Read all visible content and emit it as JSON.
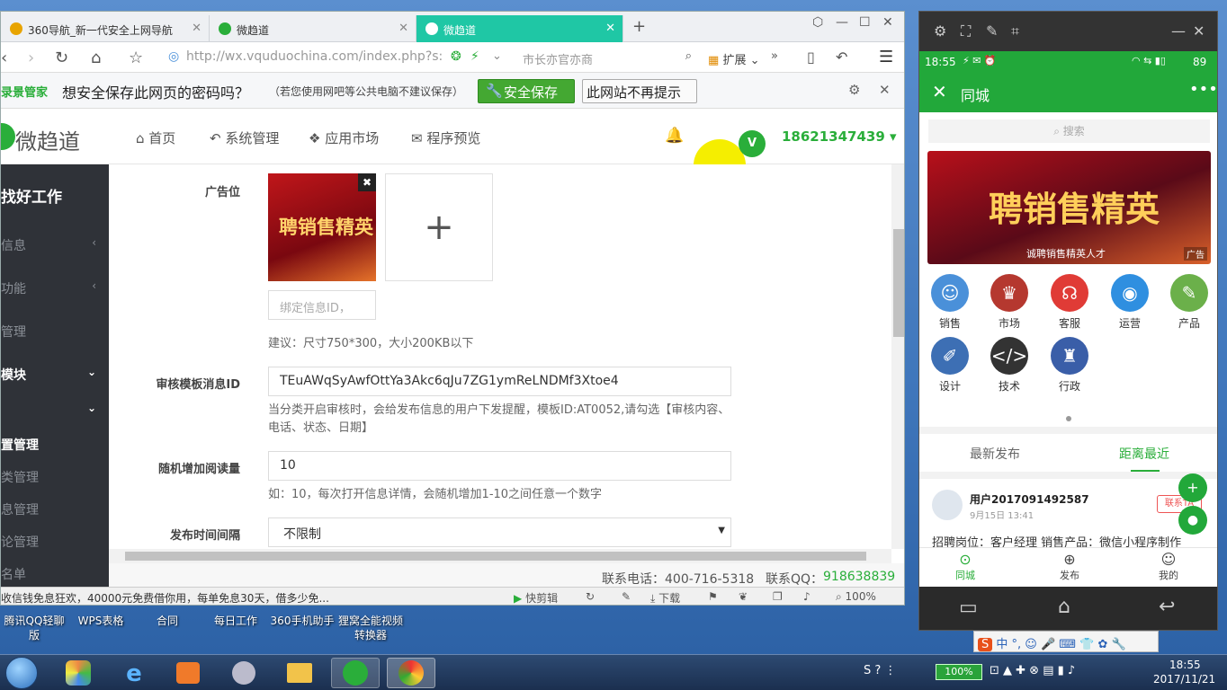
{
  "browser": {
    "tabs": [
      {
        "label": "360导航_新一代安全上网导航",
        "color": "#e8a400"
      },
      {
        "label": "微趋道",
        "color": "#2aae3a"
      },
      {
        "label": "微趋道",
        "color": "#2aae3a"
      }
    ],
    "new_tab": "+",
    "url": "http://wx.vquduochina.com/index.php?s:",
    "search_placeholder": "市长亦官亦商",
    "extensions_label": "扩展",
    "password_prompt": {
      "brand": "录景管家",
      "question": "想安全保存此网页的密码吗？",
      "note": "（若您使用网吧等公共电脑不建议保存）",
      "save_label": "安全保存",
      "never_label": "此网站不再提示"
    },
    "status_text": "收信钱免息狂欢，40000元免费借你用，每单免息30天，借多少免...",
    "status_tools": [
      "快剪辑",
      "下载"
    ],
    "zoom": "100%"
  },
  "app": {
    "logo": "微趋道",
    "nav": [
      "首页",
      "系统管理",
      "应用市场",
      "程序预览"
    ],
    "user_phone": "18621347439",
    "sidebar": {
      "title": "找好工作",
      "items": [
        "信息",
        "功能",
        "管理",
        "模块",
        "",
        "置管理",
        "类管理",
        "息管理",
        "论管理",
        "名单"
      ]
    },
    "form": {
      "ad_label": "广告位",
      "bind_placeholder": "绑定信息ID，",
      "ad_hint": "建议：尺寸750*300，大小200KB以下",
      "template_label": "审核模板消息ID",
      "template_value": "TEuAWqSyAwfOttYa3Akc6qJu7ZG1ymReLNDMf3Xtoe4",
      "template_hint": "当分类开启审核时，会给发布信息的用户下发提醒，模板ID:AT0052,请勾选【审核内容、电话、状态、日期】",
      "random_label": "随机增加阅读量",
      "random_value": "10",
      "random_hint": "如：10，每次打开信息详情，会随机增加1-10之间任意一个数字",
      "interval_label": "发布时间间隔",
      "interval_value": "不限制"
    },
    "footer": {
      "phone_label": "联系电话：400-716-5318",
      "qq_label": "联系QQ：",
      "qq_value": "918638839"
    }
  },
  "phone": {
    "time": "18:55",
    "battery": "89",
    "title": "同城",
    "search": "搜索",
    "banner_tag": "广告",
    "banner_text": "聘销售精英",
    "banner_sub": "诚聘销售精英人才",
    "categories": [
      {
        "label": "销售",
        "color": "#4a90d9"
      },
      {
        "label": "市场",
        "color": "#b5382f"
      },
      {
        "label": "客服",
        "color": "#e03b36"
      },
      {
        "label": "运营",
        "color": "#2f8fe0"
      },
      {
        "label": "产品",
        "color": "#6bb04a"
      },
      {
        "label": "设计",
        "color": "#3d6fb4"
      },
      {
        "label": "技术",
        "color": "#333333"
      },
      {
        "label": "行政",
        "color": "#3a5ea8"
      }
    ],
    "tabs": [
      "最新发布",
      "距离最近"
    ],
    "post": {
      "user": "用户2017091492587",
      "date": "9月15日 13:41",
      "contact": "联系TA",
      "text": "招聘岗位：客户经理 销售产品：微信小程序制作"
    },
    "bottom_nav": [
      "同城",
      "发布",
      "我的"
    ]
  },
  "desktop": {
    "icons": [
      "腾讯QQ轻聊版",
      "WPS表格",
      "合同",
      "每日工作",
      "360手机助手",
      "狸窝全能视频转换器"
    ]
  },
  "taskbar": {
    "battery": "100%",
    "time": "18:55",
    "date": "2017/11/21"
  },
  "colors": {
    "green": "#2aae3a",
    "accent": "#1fc7a5",
    "sidebar": "#2f3238"
  }
}
